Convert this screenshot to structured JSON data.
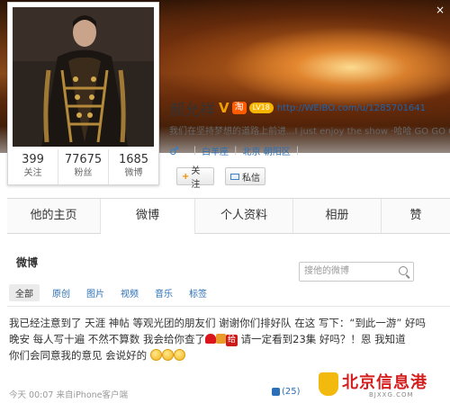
{
  "cover": {
    "close_label": "×"
  },
  "profile": {
    "name": "郝允祥",
    "verified_badge": "V",
    "taobao_badge": "淘",
    "level_badge": "LV18",
    "url": "http://WEIBO.com/u/1285701641",
    "bio": "我们在坚持梦想的道路上前进...I just enjoy the show  ·哈哈 GO GO GO",
    "gender_symbol": "♂",
    "constellation": "白羊座",
    "location": "北京 朝阳区",
    "stats": [
      {
        "value": "399",
        "label": "关注"
      },
      {
        "value": "77675",
        "label": "粉丝"
      },
      {
        "value": "1685",
        "label": "微博"
      }
    ],
    "follow_button": {
      "plus": "+",
      "label": "关注"
    },
    "message_button": {
      "label": "私信"
    }
  },
  "tabs": [
    {
      "label": "他的主页",
      "active": false
    },
    {
      "label": "微博",
      "active": true
    },
    {
      "label": "个人资料",
      "active": false
    },
    {
      "label": "相册",
      "active": false
    },
    {
      "label": "赞",
      "active": false
    }
  ],
  "feed": {
    "title": "微博",
    "search_placeholder": "搜他的微博",
    "filters": [
      "全部",
      "原创",
      "图片",
      "视频",
      "音乐",
      "标签"
    ],
    "post": {
      "line1": "我已经注意到了 天涯 神帖 等观光团的朋友们 谢谢你们排好队 在这 写下：“到此一游” 好吗",
      "line2a": "晚安 每人写十遍 不然不算数 我会给你查了",
      "gei": "给",
      "line2b": "请一定看到23集 好吗？！恩 我知道",
      "line3": "你们会同意我的意见 会说好的",
      "time": "今天 00:07",
      "source": "来自iPhone客户端",
      "likes": "(25)"
    }
  },
  "watermark": {
    "title": "北京信息港",
    "sub": "BJXXG.COM"
  },
  "colors": {
    "accent_orange": "#f28a00",
    "link_blue": "#2a6fb7",
    "watermark_red": "#d41e1e"
  }
}
